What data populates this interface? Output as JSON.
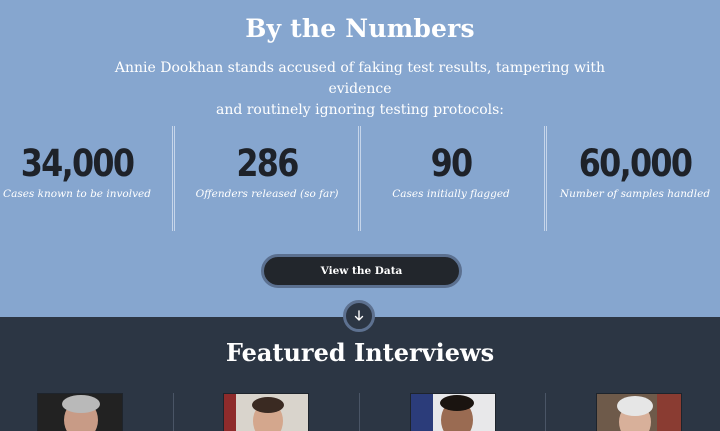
{
  "numbers": {
    "title": "By the Numbers",
    "intro_line1": "Annie Dookhan stands accused of faking test results, tampering with evidence",
    "intro_line2": "and routinely ignoring testing protocols:",
    "stats": [
      {
        "value": "34,000",
        "label": "Cases known to be involved"
      },
      {
        "value": "286",
        "label": "Offenders released (so far)"
      },
      {
        "value": "90",
        "label": "Cases initially flagged"
      },
      {
        "value": "60,000",
        "label": "Number of samples handled"
      }
    ],
    "button_label": "View the Data"
  },
  "scroll_icon": "arrow-down-icon",
  "featured": {
    "title": "Featured Interviews",
    "portraits": [
      "interviewee-1",
      "interviewee-2",
      "interviewee-3",
      "interviewee-4"
    ]
  },
  "colors": {
    "top_background": "#86a6cf",
    "bottom_background": "#2c3644",
    "number_text": "#1e2229",
    "button_background": "#22262c"
  }
}
